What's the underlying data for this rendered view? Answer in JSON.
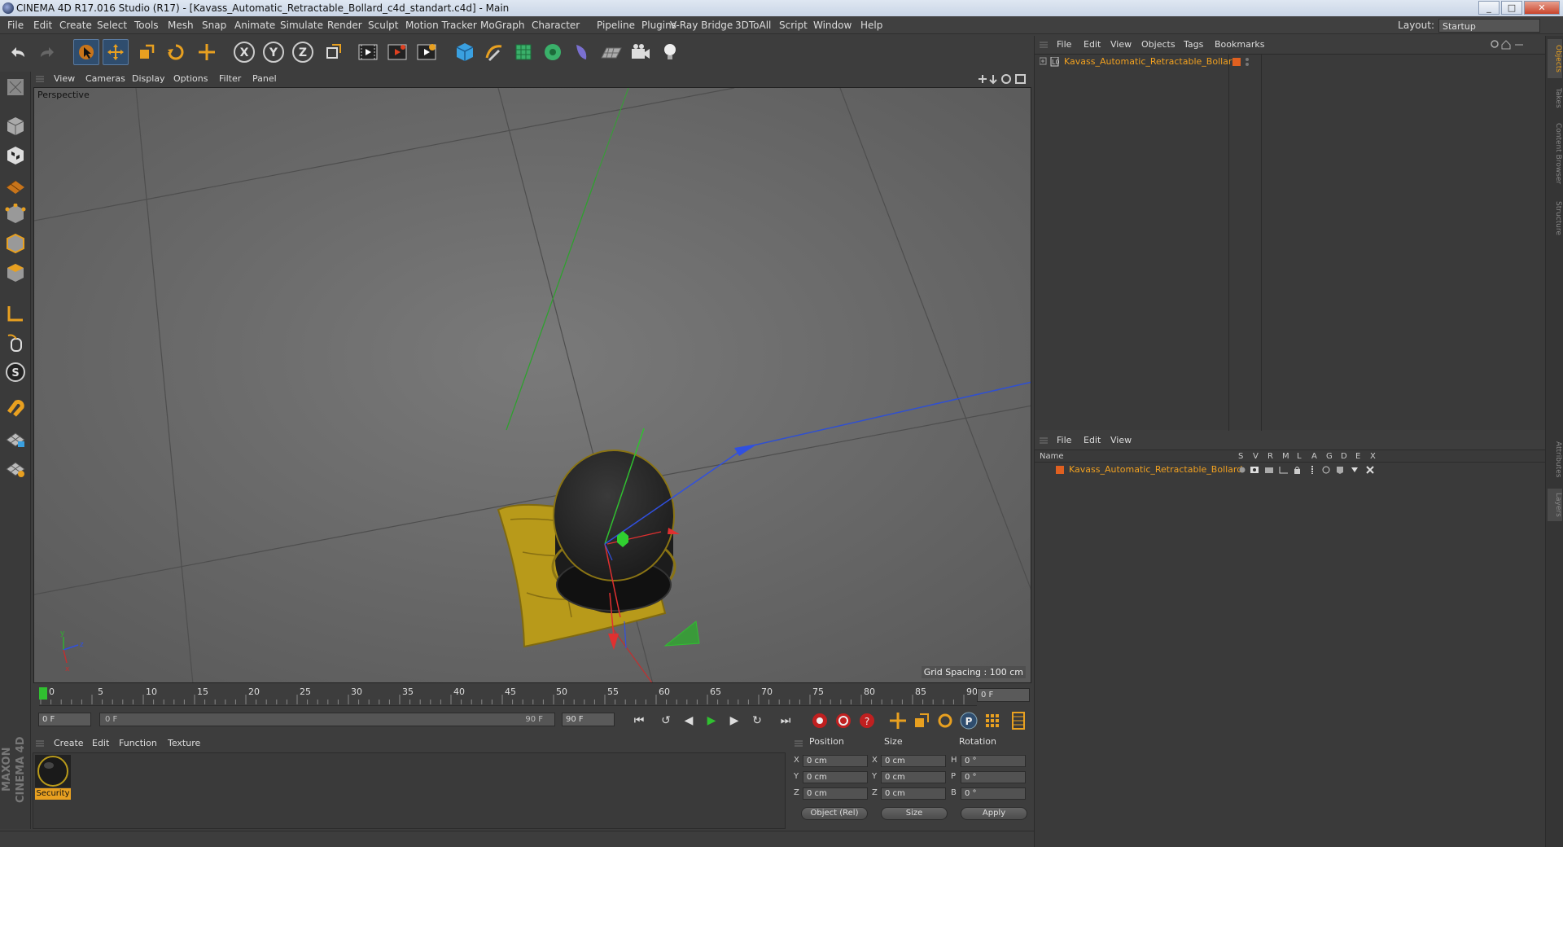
{
  "titlebar": {
    "text": "CINEMA 4D R17.016 Studio (R17) - [Kavass_Automatic_Retractable_Bollard_c4d_standart.c4d] - Main",
    "min": "_",
    "max": "□",
    "close": "✕"
  },
  "menubar": {
    "items": [
      "File",
      "Edit",
      "Create",
      "Select",
      "Tools",
      "Mesh",
      "Snap",
      "Animate",
      "Simulate",
      "Render",
      "Sculpt",
      "Motion Tracker",
      "MoGraph",
      "Character",
      "Pipeline",
      "Plugins",
      "V-Ray Bridge",
      "3DToAll",
      "Script",
      "Window",
      "Help"
    ]
  },
  "layout": {
    "label": "Layout:",
    "value": "Startup"
  },
  "toolbar": {
    "axis_x": "X",
    "axis_y": "Y",
    "axis_z": "Z"
  },
  "viewport": {
    "menu": [
      "View",
      "Cameras",
      "Display",
      "Options",
      "Filter",
      "Panel"
    ],
    "camera_label": "Perspective",
    "grid_spacing": "Grid Spacing : 100 cm",
    "colors": {
      "bg": "#6e6e6e",
      "axis_x": "#e03030",
      "axis_y": "#30c030",
      "axis_z": "#3050e0",
      "base": "#b89a1a"
    }
  },
  "timeline": {
    "ticks": [
      "0",
      "5",
      "10",
      "15",
      "20",
      "25",
      "30",
      "35",
      "40",
      "45",
      "50",
      "55",
      "60",
      "65",
      "70",
      "75",
      "80",
      "85",
      "90"
    ],
    "current_frame": "0 F",
    "start": "0 F",
    "range_start": "0 F",
    "range_end": "90 F",
    "end": "90 F"
  },
  "material_manager": {
    "menu": [
      "Create",
      "Edit",
      "Function",
      "Texture"
    ],
    "material_name": "Security"
  },
  "coordinates": {
    "headers": {
      "position": "Position",
      "size": "Size",
      "rotation": "Rotation"
    },
    "axes": [
      "X",
      "Y",
      "Z"
    ],
    "rot_axes": [
      "H",
      "P",
      "B"
    ],
    "position": [
      "0 cm",
      "0 cm",
      "0 cm"
    ],
    "size": [
      "0 cm",
      "0 cm",
      "0 cm"
    ],
    "rotation": [
      "0 °",
      "0 °",
      "0 °"
    ],
    "mode": "Object (Rel)",
    "size_mode": "Size",
    "apply": "Apply"
  },
  "object_manager": {
    "menu": [
      "File",
      "Edit",
      "View",
      "Objects",
      "Tags",
      "Bookmarks"
    ],
    "object_name": "Kavass_Automatic_Retractable_Bollard"
  },
  "layer_manager": {
    "menu": [
      "File",
      "Edit",
      "View"
    ],
    "columns": [
      "Name",
      "S",
      "V",
      "R",
      "M",
      "L",
      "A",
      "G",
      "D",
      "E",
      "X"
    ],
    "layer_name": "Kavass_Automatic_Retractable_Bollard"
  },
  "side_tabs": [
    "Objects",
    "Takes",
    "Content Browser",
    "Structure",
    "Attributes",
    "Layers"
  ],
  "brand": "MAXON CINEMA 4D"
}
